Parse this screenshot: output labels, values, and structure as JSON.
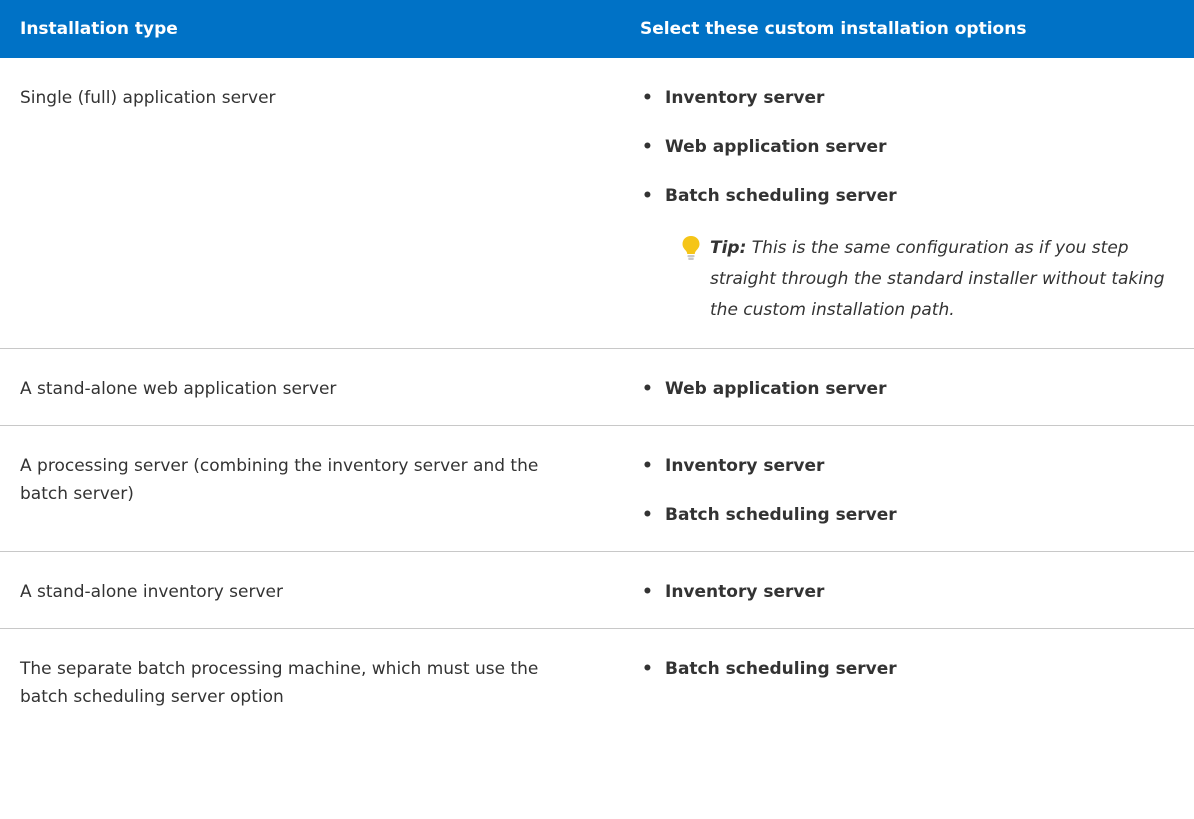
{
  "table": {
    "headers": {
      "installation_type": "Installation type",
      "options": "Select these custom installation options"
    },
    "rows": [
      {
        "type": "Single (full) application server",
        "options": [
          "Inventory server",
          "Web application server",
          "Batch scheduling server"
        ],
        "tip": {
          "label": "Tip:",
          "text": "This is the same configuration as if you step straight through the standard installer without taking the custom installation path."
        }
      },
      {
        "type": "A stand-alone web application server",
        "options": [
          "Web application server"
        ]
      },
      {
        "type": "A processing server (combining the inventory server and the batch server)",
        "options": [
          "Inventory server",
          "Batch scheduling server"
        ]
      },
      {
        "type": "A stand-alone inventory server",
        "options": [
          "Inventory server"
        ]
      },
      {
        "type": "The separate batch processing machine, which must use the batch scheduling server option",
        "options": [
          "Batch scheduling server"
        ]
      }
    ]
  },
  "colors": {
    "header_bg": "#0072c6",
    "header_text": "#ffffff",
    "tip_icon": "#f5c518"
  },
  "icons": {
    "tip": "lightbulb-icon"
  }
}
